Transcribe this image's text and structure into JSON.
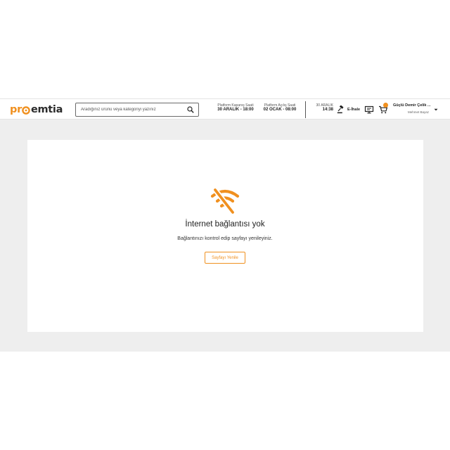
{
  "header": {
    "logo": {
      "part1": "pr",
      "part2": "emtia"
    },
    "search": {
      "placeholder": "Aradığınız ürünü veya kategoriyi yazınız",
      "value": ""
    },
    "platform_close": {
      "label": "Platform Kapanış Saati",
      "value": "30 ARALIK - 18:00"
    },
    "platform_open": {
      "label": "Platform Açılış Saati",
      "value": "02 OCAK - 08:00"
    },
    "clock": {
      "date": "30 ARALIK",
      "time": "14:38"
    },
    "ihale_label": "E-İhale",
    "cart_badge_color": "#f0901f",
    "account": {
      "company": "Güçlü Demir Çelik ...",
      "user": "Mehmet Bayaz"
    },
    "icons": [
      "search-icon",
      "gavel-icon",
      "monitor-icon",
      "cart-icon",
      "chevron-down-icon"
    ]
  },
  "error": {
    "icon": "wifi-off-icon",
    "title": "İnternet bağlantısı yok",
    "message": "Bağlantınızı kontrol edip sayfayı yenileyiniz.",
    "button_label": "Sayfayı Yenile"
  },
  "colors": {
    "accent": "#f0901f",
    "page_bg": "#eeeeee",
    "card_bg": "#ffffff"
  }
}
